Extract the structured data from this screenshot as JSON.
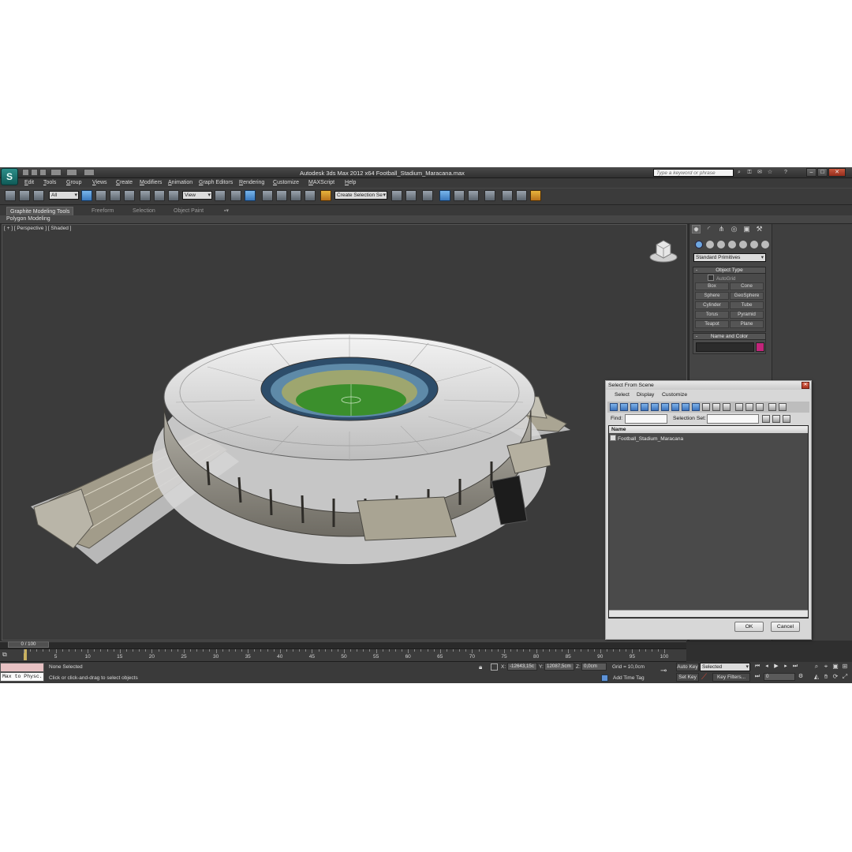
{
  "app": {
    "logo": "S",
    "title": "Autodesk 3ds Max  2012 x64     Football_Stadium_Maracana.max",
    "search_placeholder": "Type a keyword or phrase"
  },
  "menu": [
    "Edit",
    "Tools",
    "Group",
    "Views",
    "Create",
    "Modifiers",
    "Animation",
    "Graph Editors",
    "Rendering",
    "Customize",
    "MAXScript",
    "Help"
  ],
  "toolbar": {
    "selection_filter": "All",
    "ref_coord": "View",
    "selection_set": "Create Selection Se"
  },
  "ribbon": {
    "tabs": [
      "Graphite Modeling Tools",
      "Freeform",
      "Selection",
      "Object Paint"
    ],
    "panel": "Polygon Modeling"
  },
  "viewport": {
    "label": "[ + ] [ Perspective ] [ Shaded ]"
  },
  "command_panel": {
    "dropdown": "Standard Primitives",
    "object_type_title": "Object Type",
    "autogrid": "AutoGrid",
    "buttons": [
      "Box",
      "Cone",
      "Sphere",
      "GeoSphere",
      "Cylinder",
      "Tube",
      "Torus",
      "Pyramid",
      "Teapot",
      "Plane"
    ],
    "name_color_title": "Name and Color",
    "object_color": "#c2257a"
  },
  "dialog": {
    "title": "Select From Scene",
    "menu": [
      "Select",
      "Display",
      "Customize"
    ],
    "find_label": "Find:",
    "selection_set_label": "Selection Set:",
    "column_header": "Name",
    "rows": [
      "Football_Stadium_Maracana"
    ],
    "ok": "OK",
    "cancel": "Cancel"
  },
  "timeline": {
    "frame_display": "0 / 100",
    "ticks": [
      "5",
      "10",
      "15",
      "20",
      "25",
      "30",
      "35",
      "40",
      "45",
      "50",
      "55",
      "60",
      "65",
      "70",
      "75",
      "80",
      "85",
      "90",
      "95",
      "100"
    ]
  },
  "status": {
    "maxscript": "Max to Physc.",
    "selection": "None Selected",
    "prompt": "Click or click-and-drag to select objects",
    "x_label": "X:",
    "x_value": "-12643,15c",
    "y_label": "Y:",
    "y_value": "12087,5cm",
    "z_label": "Z:",
    "z_value": "0,0cm",
    "grid": "Grid = 10,0cm",
    "add_time_tag": "Add Time Tag",
    "auto_key": "Auto Key",
    "auto_key_mode": "Selected",
    "set_key": "Set Key",
    "key_filters": "Key Filters...",
    "frame": "0"
  }
}
